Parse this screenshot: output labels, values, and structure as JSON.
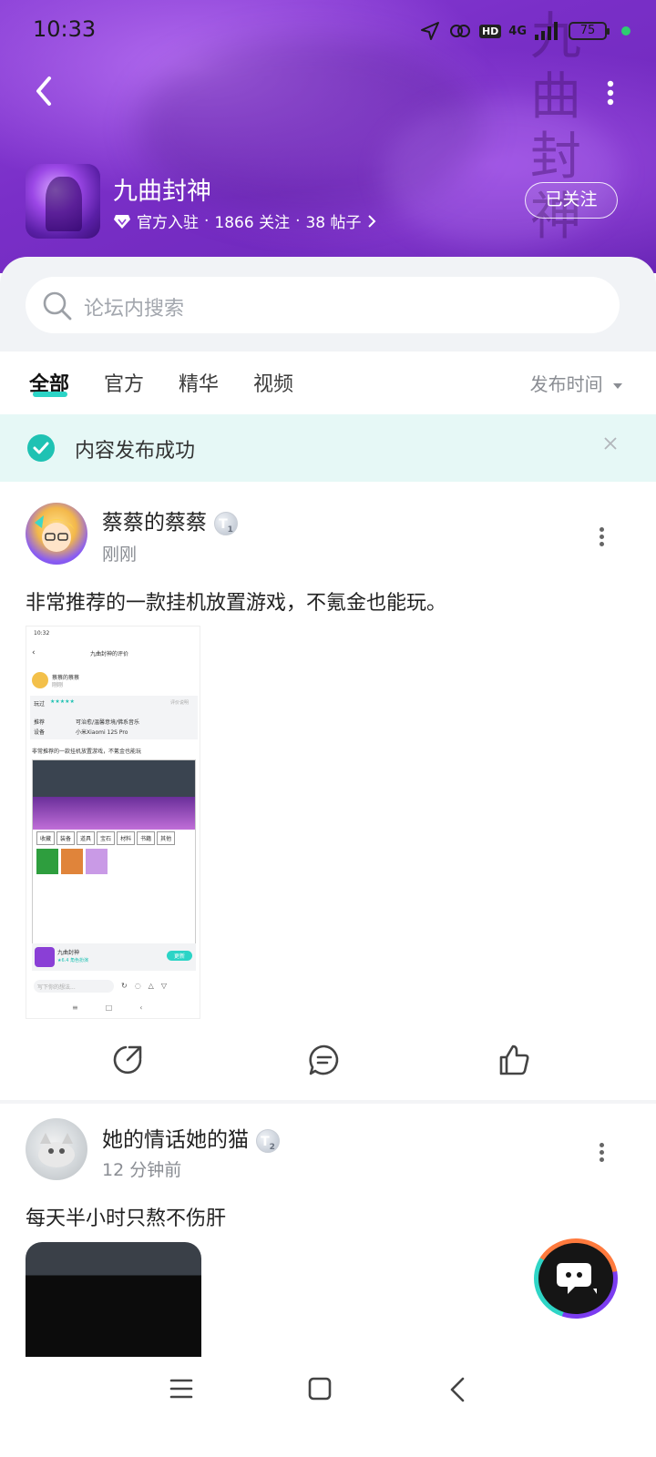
{
  "status_bar": {
    "time": "10:33",
    "battery": "75",
    "network": "4G",
    "hd": "HD"
  },
  "header": {
    "watermark": "九曲封神",
    "title": "九曲封神",
    "badge_text": "官方入驻",
    "followers": "1866 关注",
    "posts": "38 帖子",
    "separator": "·",
    "follow_label": "已关注"
  },
  "search": {
    "placeholder": "论坛内搜索"
  },
  "tabs": [
    {
      "label": "全部",
      "active": true
    },
    {
      "label": "官方"
    },
    {
      "label": "精华"
    },
    {
      "label": "视频"
    }
  ],
  "sort_label": "发布时间",
  "toast": {
    "text": "内容发布成功"
  },
  "posts": [
    {
      "user": "蔡蔡的蔡蔡",
      "level": "1",
      "time": "刚刚",
      "text": "非常推荐的一款挂机放置游戏，不氪金也能玩。",
      "screenshot": {
        "time": "10:32",
        "title": "九曲封神的评价",
        "user": "蔡蔡的蔡蔡",
        "user_time": "刚刚",
        "played": "玩过",
        "stars": "★★★★★",
        "rate_hint": "评价说明",
        "row1_label": "推荐",
        "row1_value": "可治愈/温馨意境/佛系音乐",
        "row2_label": "设备",
        "row2_value": "小米Xiaomi 12S Pro",
        "text": "非常推荐的一款挂机放置游戏，不氪金也能玩",
        "tabs": [
          "收藏",
          "装备",
          "道具",
          "宝石",
          "材料",
          "书籍",
          "其他"
        ],
        "game_name": "九曲封神",
        "game_score": "★6.4 角色扮演",
        "update": "更新",
        "comment_ph": "写下你的想法..."
      }
    },
    {
      "user": "她的情话她的猫",
      "level": "2",
      "time": "12 分钟前",
      "text": "每天半小时只熬不伤肝"
    }
  ]
}
